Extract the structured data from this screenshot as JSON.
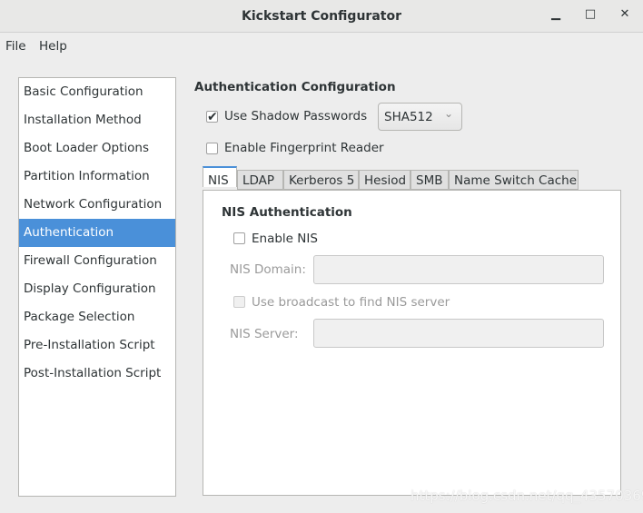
{
  "window": {
    "title": "Kickstart Configurator",
    "min": "▁",
    "max": "□",
    "close": "✕"
  },
  "menu": [
    "File",
    "Help"
  ],
  "sidebar": {
    "items": [
      "Basic Configuration",
      "Installation Method",
      "Boot Loader Options",
      "Partition Information",
      "Network Configuration",
      "Authentication",
      "Firewall Configuration",
      "Display Configuration",
      "Package Selection",
      "Pre-Installation Script",
      "Post-Installation Script"
    ],
    "selected": "Authentication",
    "accent": "#4a90d9"
  },
  "main": {
    "heading": "Authentication Configuration",
    "shadow": {
      "label": "Use Shadow Passwords",
      "checked": true,
      "check": "✔"
    },
    "hash": {
      "value": "SHA512",
      "arrow": "⌄"
    },
    "fingerprint": {
      "label": "Enable Fingerprint Reader",
      "checked": false
    },
    "tabs": [
      "NIS",
      "LDAP",
      "Kerberos 5",
      "Hesiod",
      "SMB",
      "Name Switch Cache"
    ],
    "nis": {
      "heading": "NIS Authentication",
      "enable": "Enable NIS",
      "domain_label": "NIS Domain:",
      "domain_value": "",
      "broadcast": "Use broadcast to find NIS server",
      "server_label": "NIS Server:",
      "server_value": ""
    }
  },
  "watermark": "https://blog.csdn.net/qq_43570369"
}
